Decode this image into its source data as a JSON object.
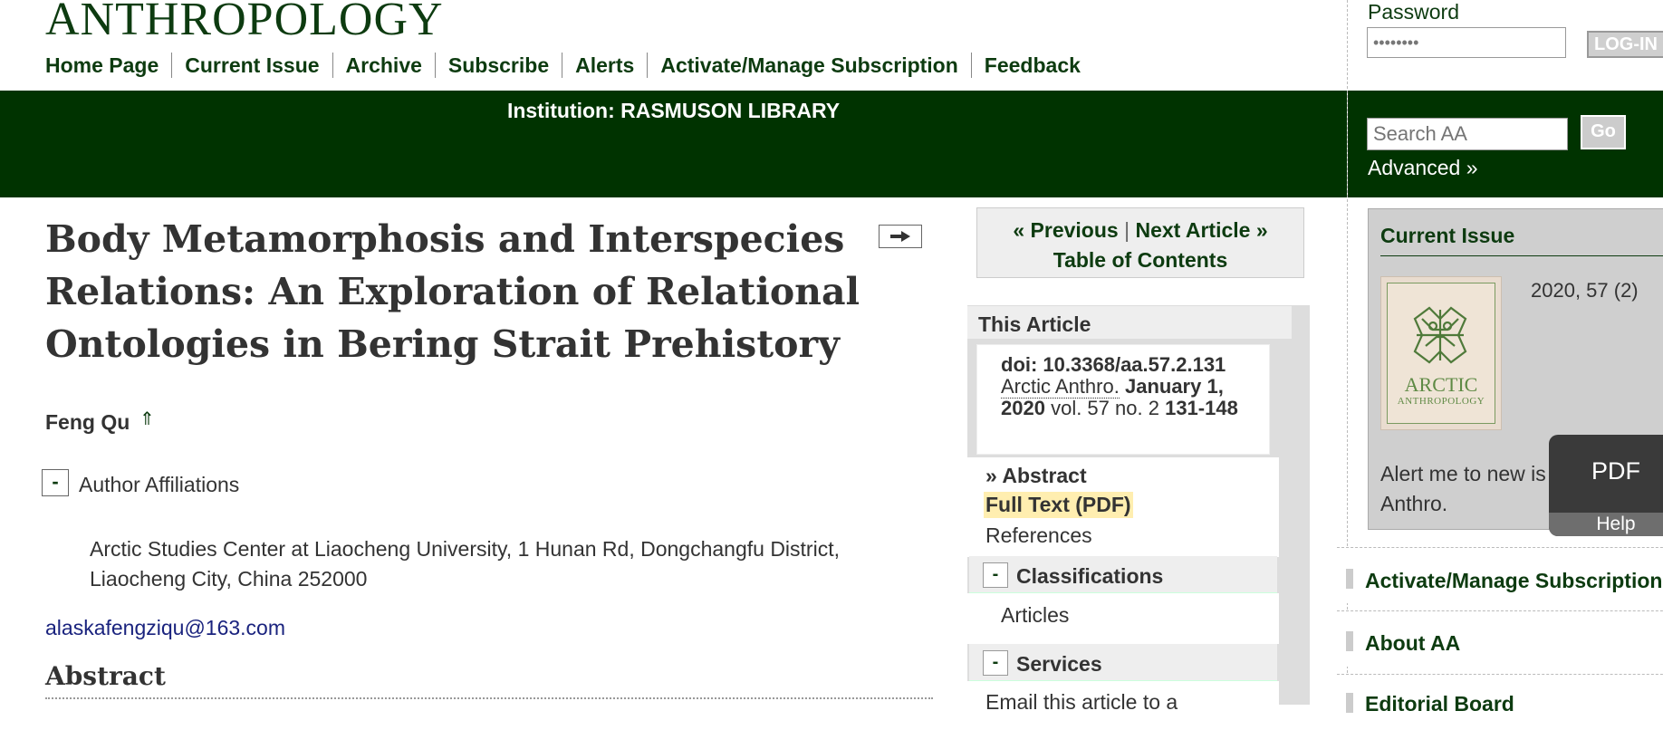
{
  "header": {
    "logo": "ANTHROPOLOGY",
    "nav": [
      "Home Page",
      "Current Issue",
      "Archive",
      "Subscribe",
      "Alerts",
      "Activate/Manage Subscription",
      "Feedback"
    ],
    "institution": "Institution: RASMUSON LIBRARY"
  },
  "login": {
    "password_label": "Password",
    "password_value": "••••••••",
    "login_button": "LOG-IN"
  },
  "search": {
    "placeholder": "Search AA",
    "go_button": "Go",
    "advanced_link": "Advanced »"
  },
  "article": {
    "title": "Body Metamorphosis and Interspecies Relations: An Exploration of Relational Ontologies in Bering Strait Prehistory",
    "share_icon": "arrow-right-icon",
    "author": "Feng Qu",
    "author_marker": "⇑",
    "affiliations_toggle": "-",
    "affiliations_label": "Author Affiliations",
    "affiliation": "Arctic Studies Center at Liaocheng University, 1 Hunan Rd, Dongchangfu District, Liaocheng City, China 252000",
    "email": "alaskafengziqu@163.com",
    "abstract_heading": "Abstract"
  },
  "pager": {
    "previous": "« Previous",
    "separator": "|",
    "next": "Next Article »",
    "toc": "Table of Contents"
  },
  "this_article": {
    "heading": "This Article",
    "doi": "doi: 10.3368/aa.57.2.131",
    "journal": "Arctic Anthro.",
    "date": "January 1, 2020",
    "volume_text": "vol. 57 no. 2",
    "pages": "131-148",
    "links": {
      "abstract": "» Abstract",
      "full_text": "Full Text (PDF)",
      "references": "References"
    }
  },
  "classifications": {
    "toggle": "-",
    "label": "Classifications",
    "item": "Articles"
  },
  "services": {
    "toggle": "-",
    "label": "Services",
    "item": "Email this article to a"
  },
  "current_issue": {
    "title": "Current Issue",
    "date": "2020, 57 (2)",
    "cover_title": "ARCTIC",
    "cover_subtitle": "ANTHROPOLOGY",
    "alert_text": "Alert me to new is",
    "alert_text_2": "Anthro."
  },
  "pdf_widget": {
    "label": "PDF",
    "help": "Help"
  },
  "sidebar_links": [
    "Activate/Manage Subscription",
    "About AA",
    "Editorial Board"
  ],
  "colors": {
    "brand_green": "#003300",
    "link_green": "#0d3b10",
    "email_blue": "#1a237e",
    "highlight": "#ffeeb0"
  }
}
